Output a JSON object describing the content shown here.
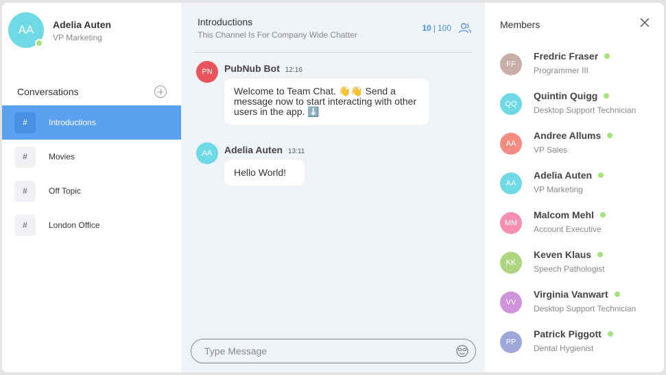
{
  "profile": {
    "initials": "AA",
    "name": "Adelia Auten",
    "title": "VP Marketing",
    "avatar_color": "#6fdae5"
  },
  "conversations": {
    "title": "Conversations",
    "channels": [
      {
        "icon": "#",
        "label": "Introductions",
        "active": true
      },
      {
        "icon": "#",
        "label": "Movies"
      },
      {
        "icon": "#",
        "label": "Off Topic"
      },
      {
        "icon": "#",
        "label": "London Office"
      }
    ]
  },
  "chat": {
    "title": "Introductions",
    "subtitle": "This Channel Is For Company Wide Chatter",
    "online_count": "10",
    "total_count": "100",
    "messages": [
      {
        "initials": "PN",
        "sender": "PubNub Bot",
        "time": "12:16",
        "avatar_color": "#e9545c",
        "text": "Welcome to Team Chat. 👋👋 Send a message now to start interacting with other users in the app. ⬇️"
      },
      {
        "initials": "AA",
        "sender": "Adelia Auten",
        "time": "13:11",
        "avatar_color": "#6fdae5",
        "text": "Hello World!"
      }
    ],
    "composer_placeholder": "Type Message"
  },
  "members": {
    "title": "Members",
    "list": [
      {
        "initials": "FF",
        "name": "Fredric Fraser",
        "title": "Programmer III",
        "color": "#c9ada7"
      },
      {
        "initials": "QQ",
        "name": "Quintin Quigg",
        "title": "Desktop Support Technician",
        "color": "#6fdae5"
      },
      {
        "initials": "AA",
        "name": "Andree Allums",
        "title": "VP Sales",
        "color": "#f28b82"
      },
      {
        "initials": "AA",
        "name": "Adelia Auten",
        "title": "VP Marketing",
        "color": "#6fdae5"
      },
      {
        "initials": "MM",
        "name": "Malcom Mehl",
        "title": "Account Executive",
        "color": "#f48fb1"
      },
      {
        "initials": "KK",
        "name": "Keven Klaus",
        "title": "Speech Pathologist",
        "color": "#aed581"
      },
      {
        "initials": "VV",
        "name": "Virginia Vanwart",
        "title": "Desktop Support Technician",
        "color": "#ce93d8"
      },
      {
        "initials": "PP",
        "name": "Patrick Piggott",
        "title": "Dental Hygienist",
        "color": "#9fa8da"
      }
    ]
  },
  "colors": {
    "accent": "#5ba1ef",
    "online": "#a4e37d",
    "chat_bg": "#eff2f7"
  }
}
